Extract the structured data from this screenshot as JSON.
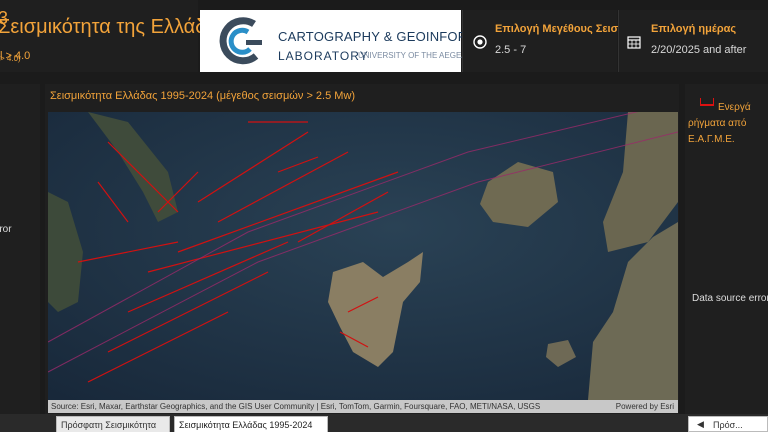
{
  "header": {
    "title": "Σεισμικότητα της Ελλάδας",
    "subtitle": "l > 4.0"
  },
  "logo": {
    "line1": "CARTOGRAPHY & GEOINFORMATICS",
    "line2": "LABORATORY",
    "line3": "UNIVERSITY OF THE AEGEAN"
  },
  "slicers": {
    "magnitude": {
      "label": "Επιλογή Μεγέθους Σεισ...",
      "value": "2.5 - 7",
      "icon": "target-icon"
    },
    "day": {
      "label": "Επιλογή ημέρας",
      "value": "2/20/2025 and after",
      "icon": "calendar-icon"
    }
  },
  "left_panel": {
    "number": "3",
    "magnitude_note": "> 4.0)",
    "error_text": "rror"
  },
  "map": {
    "title": "Σεισμικότητα Ελλάδας 1995-2024 (μέγεθος σεισμών > 2.5 Mw)",
    "attribution": "Source: Esri, Maxar, Earthstar Geographics, and the GIS User Community | Esri, TomTom, Garmin, Foursquare, FAO, METI/NASA, USGS",
    "powered_by": "Powered by Esri"
  },
  "legend": {
    "line1": "Ενεργά",
    "line2": "ρήγματα από",
    "line3": "Ε.Α.Γ.Μ.Ε.",
    "error_text": "Data source error"
  },
  "tabs": [
    {
      "label": "Πρόσφατη Σεισμικότητα"
    },
    {
      "label": "Σεισμικότητα Ελλάδας 1995-2024"
    }
  ],
  "pager": {
    "label": "Πρόσ..."
  },
  "colors": {
    "accent": "#f2a33a",
    "fault": "#d11111",
    "panel": "#1f1f1f"
  }
}
